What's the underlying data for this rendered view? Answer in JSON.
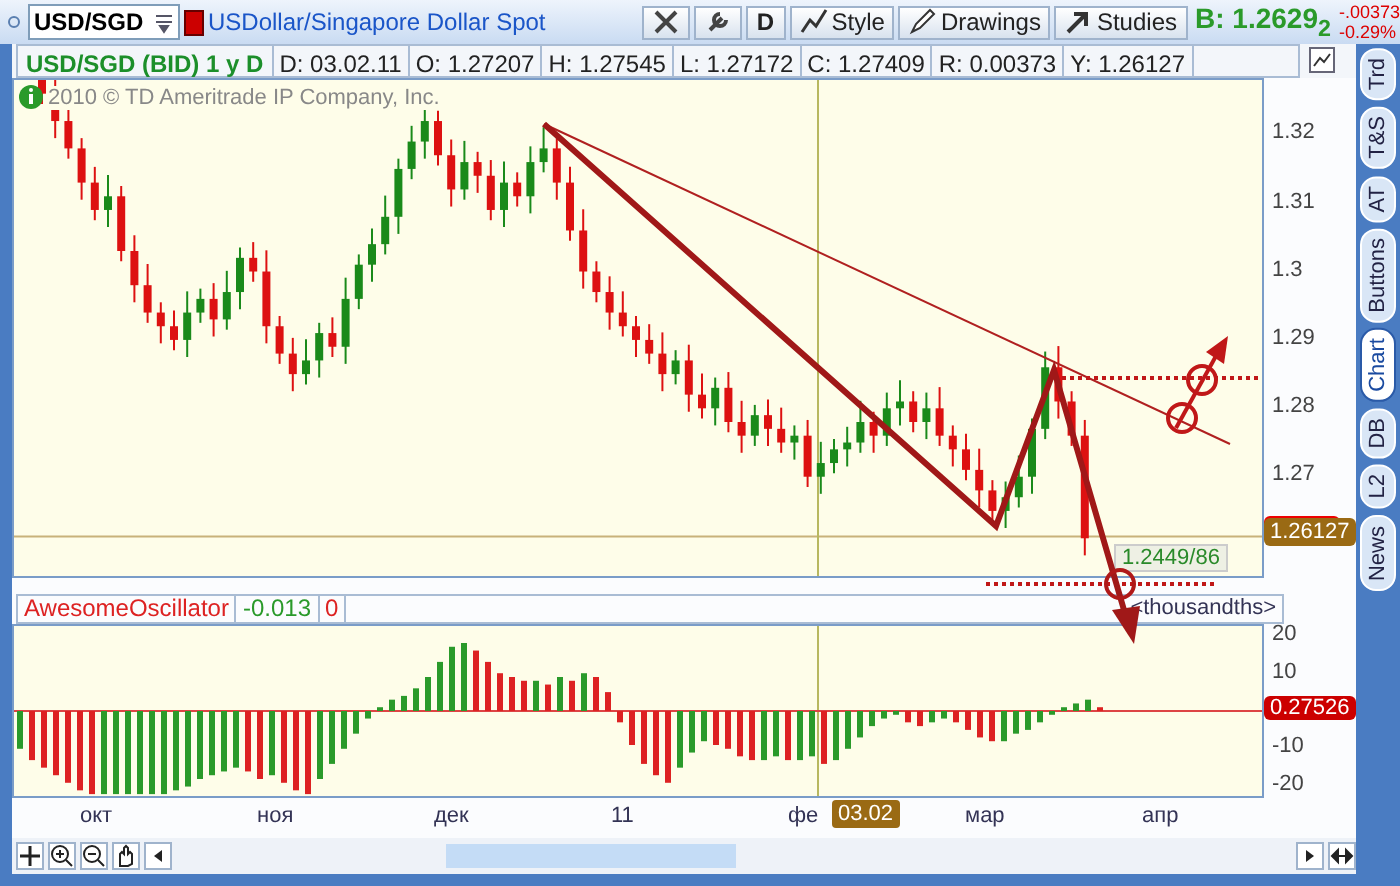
{
  "toolbar": {
    "symbol": "USD/SGD",
    "description": "USDollar/Singapore Dollar Spot",
    "buttons": [
      {
        "kind": "icon"
      },
      {
        "kind": "icon"
      },
      {
        "kind": "text",
        "label": "D"
      },
      {
        "kind": "icon_text",
        "label": "Style"
      },
      {
        "kind": "icon_text",
        "label": "Drawings"
      },
      {
        "kind": "icon_text",
        "label": "Studies"
      }
    ],
    "quote": {
      "bid": "B: 1.2629$_{2}$",
      "change": "-.00373",
      "change_pct": "-0.29%"
    }
  },
  "info_bar": {
    "title": "USD/SGD (BID) 1 y D",
    "fields": [
      "D: 03.02.11",
      "O: 1.27207",
      "H: 1.27545",
      "L: 1.27172",
      "C: 1.27409",
      "R: 0.00373",
      "Y: 1.26127"
    ]
  },
  "price_chart": {
    "copyright": "2010 © TD Ameritrade IP Company, Inc.",
    "level_label": "1.2449/86",
    "last_price": "1.26127",
    "y_axis_labels": [
      "1.32",
      "1.31",
      "1.3",
      "1.29",
      "1.28",
      "1.27"
    ]
  },
  "oscillator": {
    "name": "AwesomeOscillator",
    "value": "-0.013",
    "signal": "0",
    "units": "<thousandths>",
    "last_value": "0.27526",
    "y_axis_labels": [
      "20",
      "10",
      "-10",
      "-20"
    ]
  },
  "x_axis": {
    "labels": [
      "окт",
      "ноя",
      "дек",
      "11",
      "фе",
      "мар",
      "апр"
    ],
    "cursor_label": "03.02"
  },
  "side_tabs": [
    {
      "label": "Trd",
      "selected": false
    },
    {
      "label": "T&S",
      "selected": false
    },
    {
      "label": "AT",
      "selected": false
    },
    {
      "label": "Buttons",
      "selected": false
    },
    {
      "label": "Chart",
      "selected": true
    },
    {
      "label": "DB",
      "selected": false
    },
    {
      "label": "L2",
      "selected": false
    },
    {
      "label": "News",
      "selected": false
    }
  ]
}
